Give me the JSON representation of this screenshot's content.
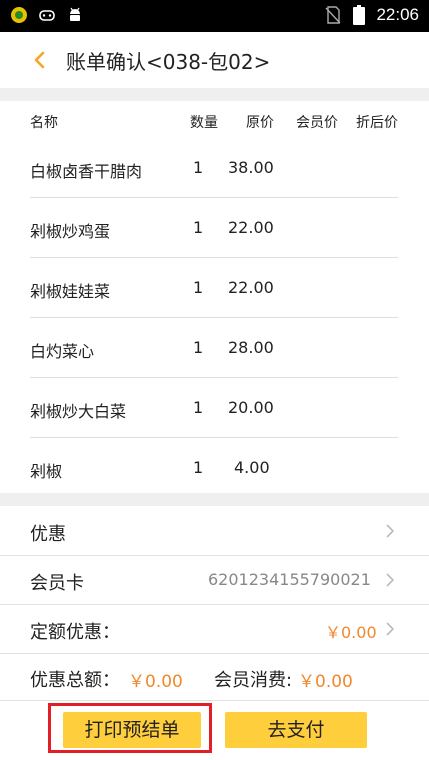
{
  "status_bar": {
    "time": "22:06",
    "icons": [
      "app-badge-icon",
      "gamepad-icon",
      "android-icon",
      "no-sim-icon",
      "battery-icon"
    ]
  },
  "header": {
    "back_icon": "chevron-left-icon",
    "title": "账单确认<038-包02>"
  },
  "table": {
    "columns": [
      "名称",
      "数量",
      "原价",
      "会员价",
      "折后价"
    ],
    "rows": [
      {
        "name": "白椒卤香干腊肉",
        "qty": "1",
        "price": "38.00",
        "member_price": "",
        "discount_price": ""
      },
      {
        "name": "剁椒炒鸡蛋",
        "qty": "1",
        "price": "22.00",
        "member_price": "",
        "discount_price": ""
      },
      {
        "name": "剁椒娃娃菜",
        "qty": "1",
        "price": "22.00",
        "member_price": "",
        "discount_price": ""
      },
      {
        "name": "白灼菜心",
        "qty": "1",
        "price": "28.00",
        "member_price": "",
        "discount_price": ""
      },
      {
        "name": "剁椒炒大白菜",
        "qty": "1",
        "price": "20.00",
        "member_price": "",
        "discount_price": ""
      },
      {
        "name": "剁椒",
        "qty": "1",
        "price": "4.00",
        "member_price": "",
        "discount_price": ""
      }
    ]
  },
  "sections": {
    "discount_label": "优惠",
    "member_card_label": "会员卡",
    "member_card_value": "6201234155790021",
    "fixed_discount_label": "定额优惠：",
    "fixed_discount_value": "￥0.00"
  },
  "totals": {
    "total_discount_label": "优惠总额：",
    "total_discount_value": "￥0.00",
    "member_spend_label": "会员消费:",
    "member_spend_value": "￥0.00"
  },
  "buttons": {
    "print_label": "打印预结单",
    "pay_label": "去支付"
  },
  "colors": {
    "accent": "#ffce3c",
    "amount": "#f0882c",
    "highlight": "#e21f26"
  }
}
